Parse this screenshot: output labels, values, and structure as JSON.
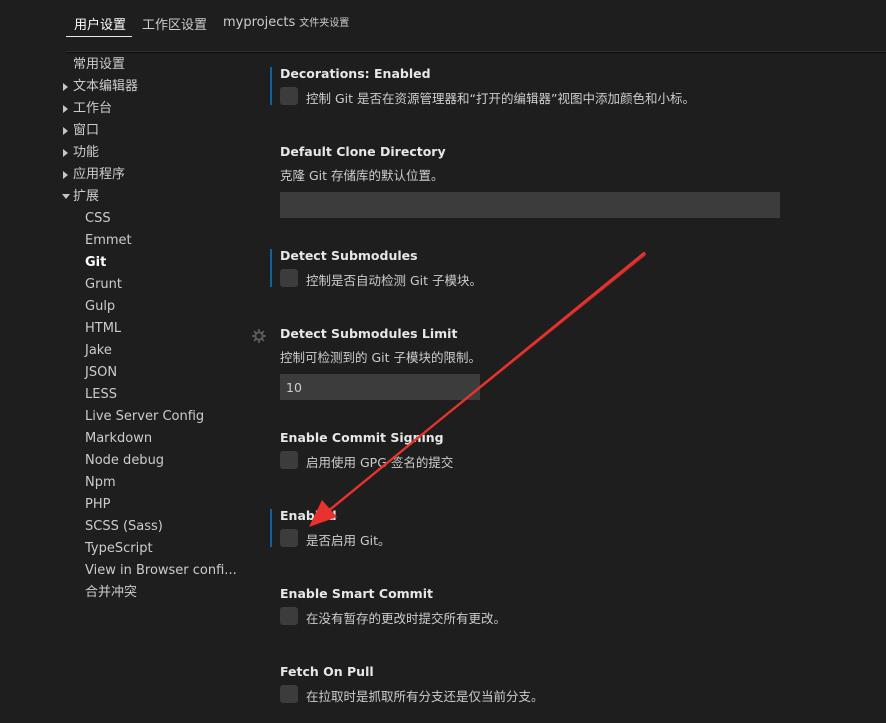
{
  "tabs": {
    "user_settings": "用户设置",
    "workspace_settings": "工作区设置",
    "folder_name": "myprojects",
    "folder_sub": "文件夹设置"
  },
  "sidebar": {
    "items": [
      {
        "label": "常用设置"
      },
      {
        "label": "文本编辑器"
      },
      {
        "label": "工作台"
      },
      {
        "label": "窗口"
      },
      {
        "label": "功能"
      },
      {
        "label": "应用程序"
      },
      {
        "label": "扩展"
      }
    ],
    "children": [
      "CSS",
      "Emmet",
      "Git",
      "Grunt",
      "Gulp",
      "HTML",
      "Jake",
      "JSON",
      "LESS",
      "Live Server Config",
      "Markdown",
      "Node debug",
      "Npm",
      "PHP",
      "SCSS (Sass)",
      "TypeScript",
      "View in Browser confi...",
      "合并冲突"
    ],
    "selected": "Git"
  },
  "settings": {
    "decorations": {
      "category": "Decorations: ",
      "name": "Enabled",
      "desc": "控制 Git 是否在资源管理器和“打开的编辑器”视图中添加颜色和小标。"
    },
    "default_clone": {
      "name": "Default Clone Directory",
      "desc": "克隆 Git 存储库的默认位置。",
      "value": ""
    },
    "detect_submodules": {
      "name": "Detect Submodules",
      "desc": "控制是否自动检测 Git 子模块。"
    },
    "detect_submodules_limit": {
      "name": "Detect Submodules Limit",
      "desc": "控制可检测到的 Git 子模块的限制。",
      "value": "10"
    },
    "commit_signing": {
      "name": "Enable Commit Signing",
      "desc": "启用使用 GPG 签名的提交"
    },
    "enabled": {
      "name": "Enabled",
      "desc": "是否启用 Git。"
    },
    "smart_commit": {
      "name": "Enable Smart Commit",
      "desc": "在没有暂存的更改时提交所有更改。"
    },
    "fetch_on_pull": {
      "name": "Fetch On Pull",
      "desc": "在拉取时是抓取所有分支还是仅当前分支。"
    }
  },
  "colors": {
    "background": "#1e1e1e",
    "modified_indicator": "#0e639c",
    "annotation_arrow": "#e8322d"
  }
}
